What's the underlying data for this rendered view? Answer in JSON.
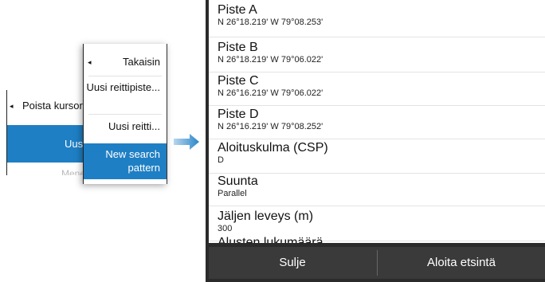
{
  "menu_back": {
    "back_label": "Poista kursori",
    "selected_label": "Uusi",
    "faded_label": "Mene"
  },
  "menu_front": {
    "back_label": "Takaisin",
    "new_waypoint": "Uusi reittipiste...",
    "new_route": "Uusi reitti...",
    "new_search": "New search pattern"
  },
  "panel": {
    "entries": [
      {
        "name": "Piste A",
        "value": "N 26°18.219' W 79°08.253'"
      },
      {
        "name": "Piste B",
        "value": "N 26°18.219' W 79°06.022'"
      },
      {
        "name": "Piste C",
        "value": "N 26°16.219' W 79°06.022'"
      },
      {
        "name": "Piste D",
        "value": "N 26°16.219' W 79°08.252'"
      },
      {
        "name": "Aloituskulma (CSP)",
        "value": "D"
      },
      {
        "name": "Suunta",
        "value": "Parallel"
      },
      {
        "name": "Jäljen leveys (m)",
        "value": "300"
      },
      {
        "name": "Alusten lukumäärä",
        "value": ""
      }
    ],
    "close_label": "Sulje",
    "start_label": "Aloita etsintä"
  },
  "colors": {
    "accent": "#1f7fc4",
    "panel_bg": "#2b2b2b",
    "button_bar": "#3a3a3a"
  }
}
